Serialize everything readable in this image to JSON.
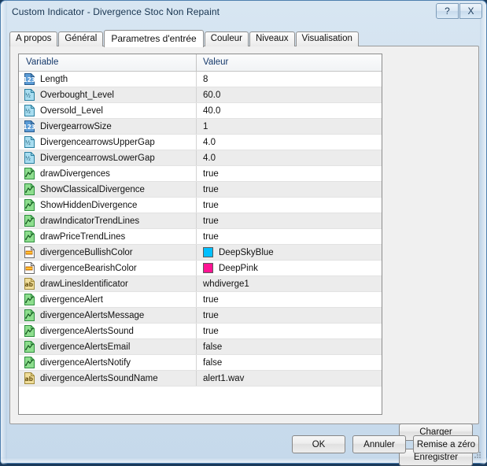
{
  "window": {
    "title": "Custom Indicator - Divergence Stoc Non Repaint",
    "help_button": "?",
    "close_button": "X"
  },
  "tabs": [
    {
      "label": "A propos",
      "active": false
    },
    {
      "label": "Général",
      "active": false
    },
    {
      "label": "Parametres d'entrée",
      "active": true
    },
    {
      "label": "Couleur",
      "active": false
    },
    {
      "label": "Niveaux",
      "active": false
    },
    {
      "label": "Visualisation",
      "active": false
    }
  ],
  "grid": {
    "columns": [
      "Variable",
      "Valeur"
    ],
    "rows": [
      {
        "icon": "int-icon",
        "variable": "Length",
        "value": "8"
      },
      {
        "icon": "double-icon",
        "variable": "Overbought_Level",
        "value": "60.0"
      },
      {
        "icon": "double-icon",
        "variable": "Oversold_Level",
        "value": "40.0"
      },
      {
        "icon": "int-icon",
        "variable": "DivergearrowSize",
        "value": "1"
      },
      {
        "icon": "double-icon",
        "variable": "DivergencearrowsUpperGap",
        "value": "4.0"
      },
      {
        "icon": "double-icon",
        "variable": "DivergencearrowsLowerGap",
        "value": "4.0"
      },
      {
        "icon": "bool-icon",
        "variable": "drawDivergences",
        "value": "true"
      },
      {
        "icon": "bool-icon",
        "variable": "ShowClassicalDivergence",
        "value": "true"
      },
      {
        "icon": "bool-icon",
        "variable": "ShowHiddenDivergence",
        "value": "true"
      },
      {
        "icon": "bool-icon",
        "variable": "drawIndicatorTrendLines",
        "value": "true"
      },
      {
        "icon": "bool-icon",
        "variable": "drawPriceTrendLines",
        "value": "true"
      },
      {
        "icon": "color-icon",
        "variable": "divergenceBullishColor",
        "value": "DeepSkyBlue",
        "swatch": "#00BFFF"
      },
      {
        "icon": "color-icon",
        "variable": "divergenceBearishColor",
        "value": "DeepPink",
        "swatch": "#FF1493"
      },
      {
        "icon": "string-icon",
        "variable": "drawLinesIdentificator",
        "value": "whdiverge1"
      },
      {
        "icon": "bool-icon",
        "variable": "divergenceAlert",
        "value": "true"
      },
      {
        "icon": "bool-icon",
        "variable": "divergenceAlertsMessage",
        "value": "true"
      },
      {
        "icon": "bool-icon",
        "variable": "divergenceAlertsSound",
        "value": "true"
      },
      {
        "icon": "bool-icon",
        "variable": "divergenceAlertsEmail",
        "value": "false"
      },
      {
        "icon": "bool-icon",
        "variable": "divergenceAlertsNotify",
        "value": "false"
      },
      {
        "icon": "string-icon",
        "variable": "divergenceAlertsSoundName",
        "value": "alert1.wav"
      }
    ]
  },
  "side_buttons": {
    "load": "Charger",
    "save": "Enregistrer"
  },
  "dialog_buttons": {
    "ok": "OK",
    "cancel": "Annuler",
    "reset": "Remise a zéro"
  }
}
